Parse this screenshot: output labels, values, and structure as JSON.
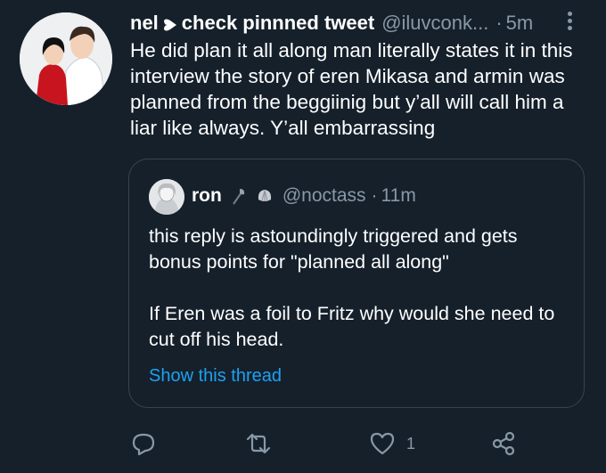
{
  "tweet": {
    "display_name": "nel",
    "name_icon": "black-heart-arrow-icon",
    "name_suffix": "check pinnned tweet",
    "handle": "@iluvconk...",
    "dot": "·",
    "time": "5m",
    "text": "He did plan it all along man literally states it in this interview the story of eren Mikasa and armin was planned from the beggiinig but y’all will call him a liar like always. Y’all embarrassing"
  },
  "quoted": {
    "display_name": "ron",
    "emojis": [
      "feather-icon",
      "shell-icon"
    ],
    "handle": "@noctass",
    "dot": "·",
    "time": "11m",
    "paragraph1": "this reply is astoundingly triggered and gets bonus points for \"planned all along\"",
    "paragraph2": "If Eren was a foil to Fritz why would she need to cut off his head.",
    "show_thread": "Show this thread"
  },
  "actions": {
    "reply_icon": "reply-icon",
    "retweet_icon": "retweet-icon",
    "like_icon": "heart-icon",
    "like_count": "1",
    "share_icon": "share-icon"
  },
  "colors": {
    "background": "#15202b",
    "secondary_text": "#8899a6",
    "link": "#1da1f2",
    "border": "#38444d"
  }
}
